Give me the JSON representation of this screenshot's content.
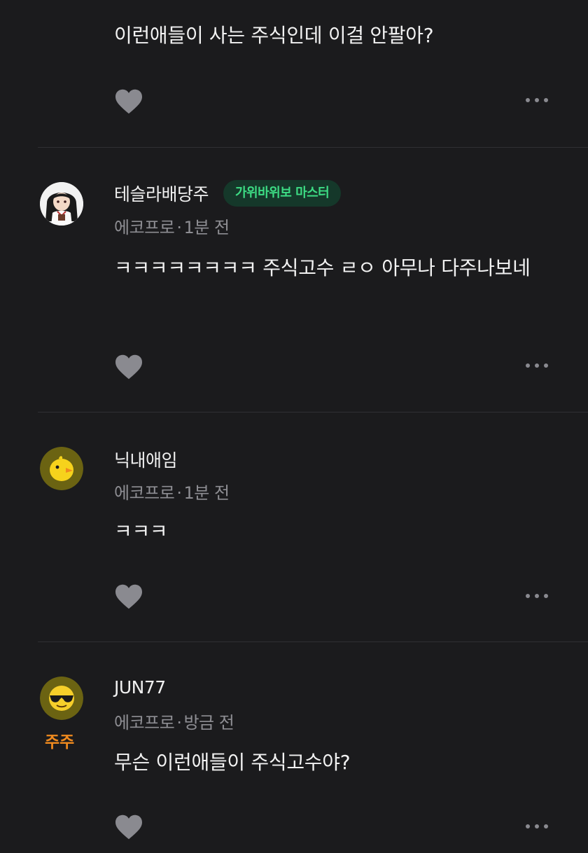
{
  "comments": [
    {
      "body": "이런애들이 사는 주식인데 이걸 안팔아?",
      "like_icon": "heart-icon",
      "more_icon": "more-dots-icon"
    },
    {
      "author": "테슬라배당주",
      "badge": "가위바위보 마스터",
      "community": "에코프로",
      "separator": "·",
      "time": "1분 전",
      "body": "ㅋㅋㅋㅋㅋㅋㅋㅋ 주식고수 ㄹㅇ 아무나 다주나보네",
      "avatar_icon": "anime-girl-avatar"
    },
    {
      "author": "닉내애임",
      "community": "에코프로",
      "separator": "·",
      "time": "1분 전",
      "body": "ㅋㅋㅋ",
      "avatar_icon": "yellow-chick-avatar"
    },
    {
      "author": "JUN77",
      "community": "에코프로",
      "separator": "·",
      "time": "방금 전",
      "body": "무슨 이런애들이 주식고수야?",
      "grade_label": "주주",
      "avatar_icon": "sunglasses-emoji-avatar"
    }
  ],
  "colors": {
    "background": "#1b1b1d",
    "badge_bg": "#15382a",
    "badge_text": "#3ddc84",
    "grade_text": "#f08a1e",
    "meta_text": "#8e8e93",
    "icon_gray": "#8a8a90"
  }
}
